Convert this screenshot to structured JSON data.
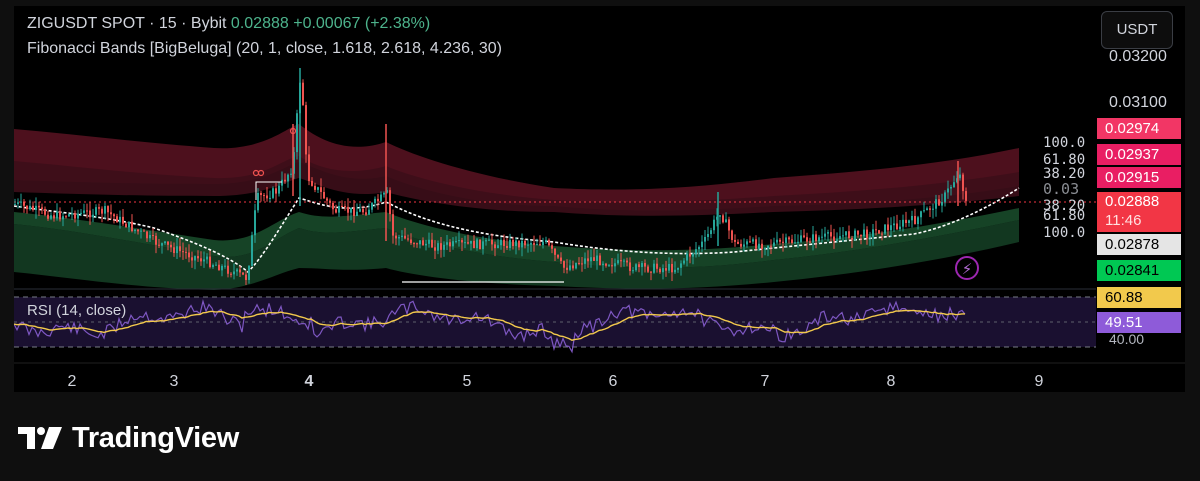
{
  "header": {
    "symbol": "ZIGUSDT SPOT",
    "separator_1": " · ",
    "interval": "15",
    "separator_2": " · ",
    "exchange": "Bybit",
    "last_price": "0.02888",
    "change_abs": "+0.00067",
    "change_pct": "(+2.38%)"
  },
  "indicator_legend": "Fibonacci Bands [BigBeluga] (20, 1, close, 1.618, 2.618, 4.236, 30)",
  "currency_button": "USDT",
  "price_axis": {
    "tick_1": "0.03200",
    "tick_2": "0.03100",
    "tick_3": "0.03"
  },
  "fib_levels_upper": [
    "100.0",
    "61.80",
    "38.20"
  ],
  "fib_levels_lower": [
    "38.20",
    "61.80",
    "100.0"
  ],
  "price_labels": [
    {
      "value": "0.02974",
      "bg": "#f23665"
    },
    {
      "value": "0.02937",
      "bg": "#e91e63"
    },
    {
      "value": "0.02915",
      "bg": "#e91e63"
    },
    {
      "value": "0.02888",
      "sub": "11:46",
      "bg": "#f23645"
    },
    {
      "value": "0.02878",
      "bg": "#e5e5e5",
      "fg": "#000000"
    },
    {
      "value": "0.02841",
      "bg": "#00c853",
      "fg": "#000000"
    }
  ],
  "rsi": {
    "title": "RSI (14, close)",
    "rsi_value": "60.88",
    "rsi_value_bg": "#f2c94c",
    "ma_value": "49.51",
    "ma_value_bg": "#8e5bd9",
    "lower_tick": "40.00"
  },
  "time_axis": [
    "2",
    "3",
    "4",
    "5",
    "6",
    "7",
    "8",
    "9"
  ],
  "lightning_icon": "⚡",
  "brand": "TradingView",
  "colors": {
    "up": "#26a69a",
    "down": "#ef5350",
    "upper_band": "#7a1f35",
    "lower_band": "#1b4d2e",
    "basis": "#ffffff",
    "rsi_line": "#7e57c2",
    "rsi_ma": "#f2c94c"
  }
}
